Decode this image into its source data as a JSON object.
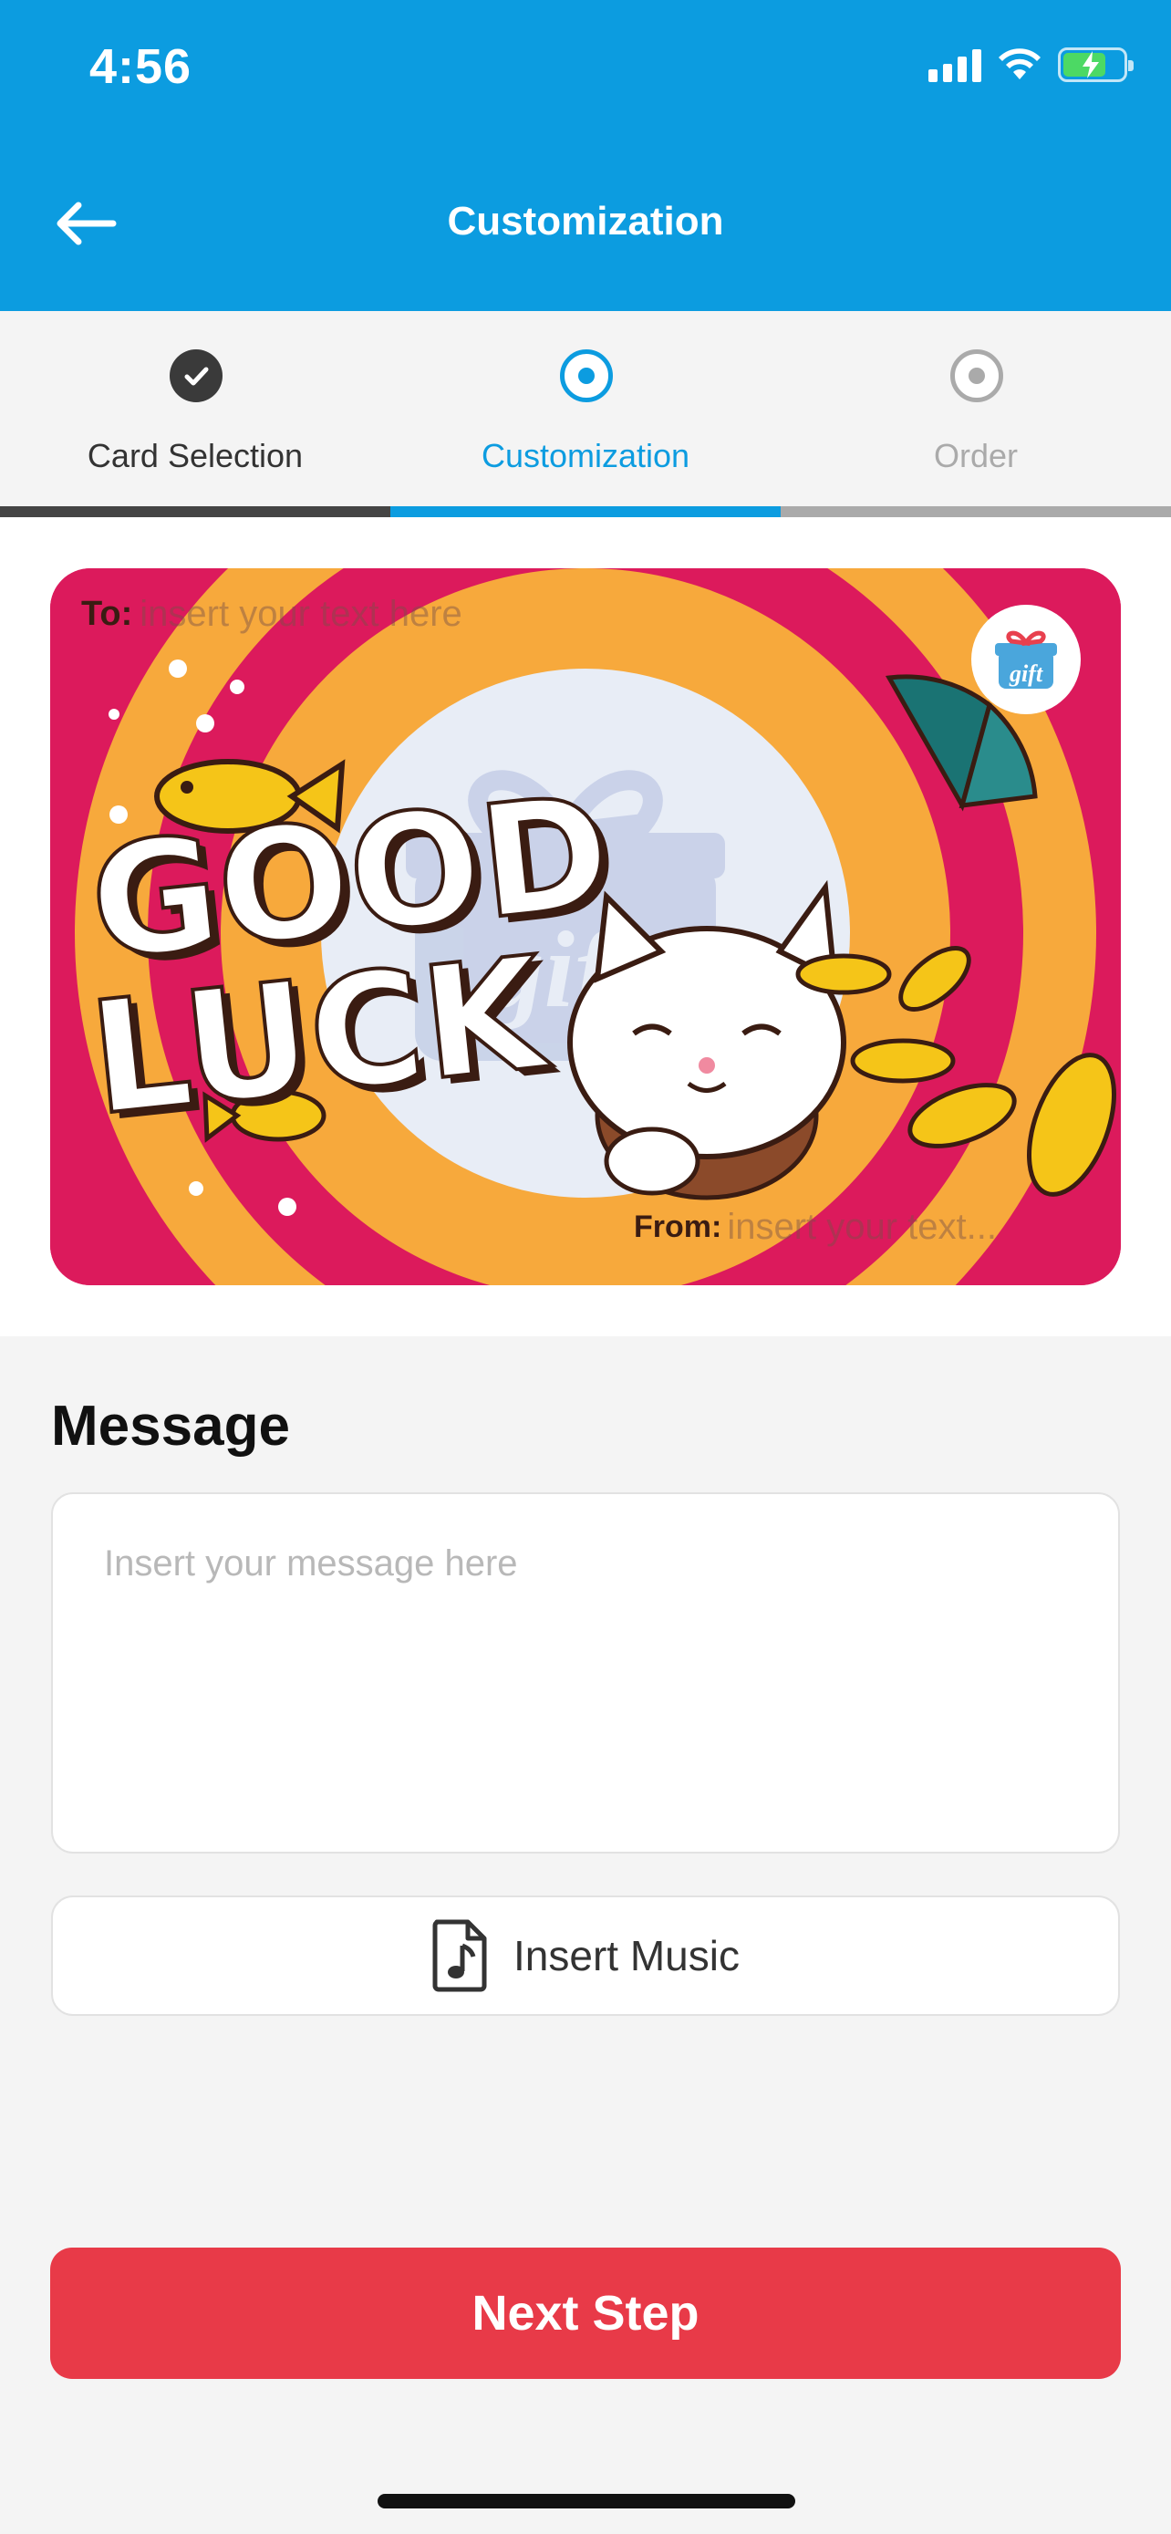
{
  "status_bar": {
    "time": "4:56"
  },
  "header": {
    "title": "Customization"
  },
  "steps": [
    {
      "label": "Card Selection",
      "state": "completed"
    },
    {
      "label": "Customization",
      "state": "active"
    },
    {
      "label": "Order",
      "state": "pending"
    }
  ],
  "card": {
    "to_label": "To:",
    "to_placeholder": "insert your text here",
    "from_label": "From:",
    "from_placeholder": "insert your text...",
    "headline_line1": "GOOD",
    "headline_line2": "LUCK",
    "badge_text": "gift",
    "watermark_text": "gift"
  },
  "message": {
    "heading": "Message",
    "placeholder": "Insert your message here",
    "value": ""
  },
  "music_button": {
    "label": "Insert Music",
    "icon": "music-file-icon"
  },
  "next_button": {
    "label": "Next Step"
  },
  "colors": {
    "primary": "#0c9ce0",
    "accent": "#e83a48",
    "card_pink": "#dc1a5c",
    "card_orange": "#f7a93c"
  }
}
